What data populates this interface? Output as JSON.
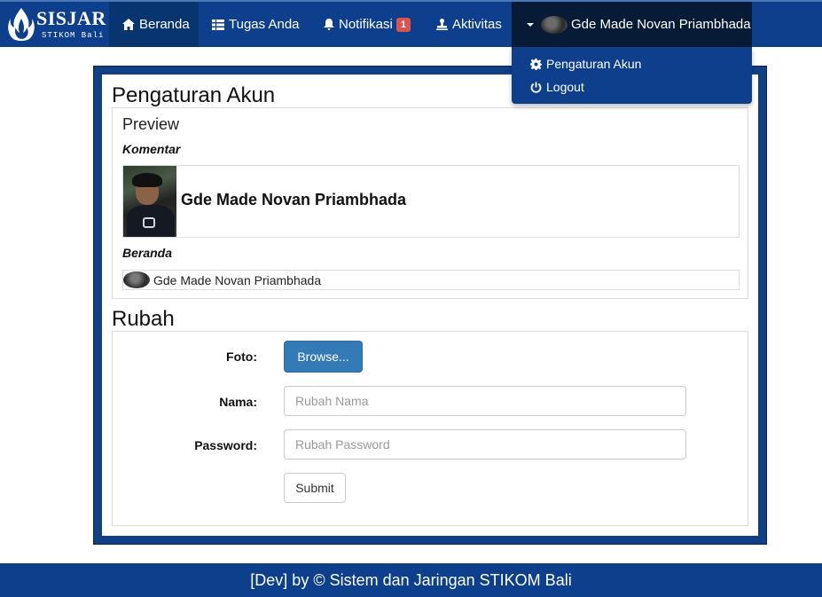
{
  "brand": {
    "title": "SISJAR",
    "subtitle": "STIKOM Bali"
  },
  "nav": {
    "home_label": "Beranda",
    "tasks_label": "Tugas Anda",
    "notif_label": "Notifikasi",
    "notif_count": "1",
    "activity_label": "Aktivitas",
    "user_name": "Gde Made Novan Priambhada"
  },
  "dropdown": {
    "settings_label": "Pengaturan Akun",
    "logout_label": "Logout"
  },
  "page": {
    "title": "Pengaturan Akun",
    "preview_heading": "Preview",
    "comment_label": "Komentar",
    "card_name": "Gde Made Novan Priambhada",
    "home_label": "Beranda",
    "row_name": "Gde Made Novan Priambhada"
  },
  "form": {
    "heading": "Rubah",
    "photo_label": "Foto:",
    "browse_label": "Browse...",
    "name_label": "Nama:",
    "name_placeholder": "Rubah Nama",
    "password_label": "Password:",
    "password_placeholder": "Rubah Password",
    "submit_label": "Submit"
  },
  "footer": {
    "text": "[Dev] by © Sistem dan Jaringan STIKOM Bali"
  },
  "colors": {
    "primary": "#0d3f8c",
    "button_primary": "#337ab7",
    "badge": "#d9534f"
  }
}
